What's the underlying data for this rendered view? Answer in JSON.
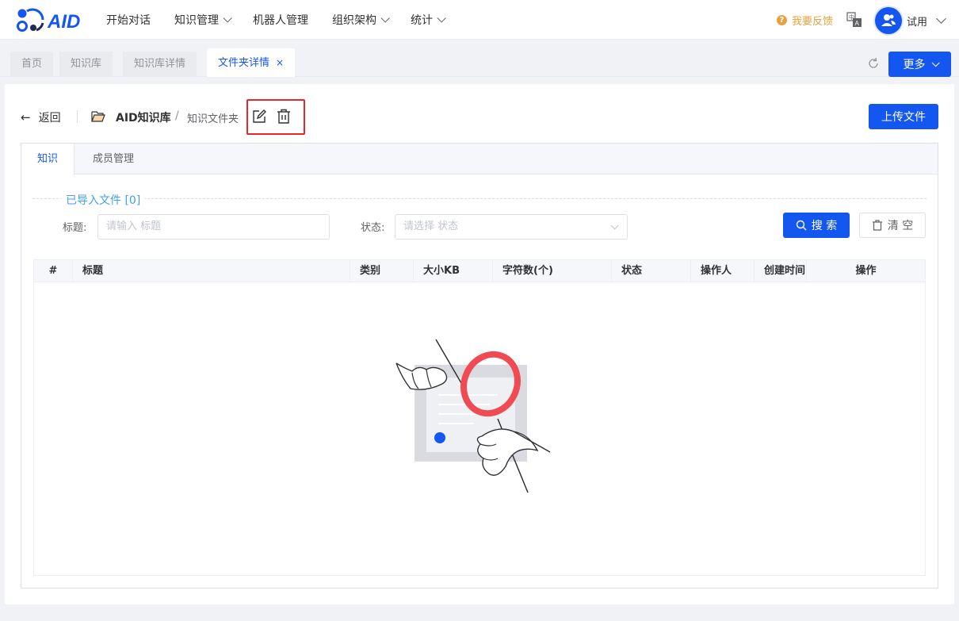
{
  "app": {
    "logo_text": "AID"
  },
  "nav": {
    "items": [
      {
        "label": "开始对话",
        "dropdown": false
      },
      {
        "label": "知识管理",
        "dropdown": true
      },
      {
        "label": "机器人管理",
        "dropdown": false
      },
      {
        "label": "组织架构",
        "dropdown": true
      },
      {
        "label": "统计",
        "dropdown": true
      }
    ],
    "feedback": "我要反馈",
    "user": "试用"
  },
  "page_tabs": [
    {
      "label": "首页",
      "active": false
    },
    {
      "label": "知识库",
      "active": false
    },
    {
      "label": "知识库详情",
      "active": false
    },
    {
      "label": "文件夹详情",
      "active": true,
      "close": "×"
    }
  ],
  "more_button": "更多",
  "header": {
    "back": "返回",
    "kb_name": "AID知识库",
    "separator": "/",
    "folder_name": "知识文件夹",
    "upload": "上传文件"
  },
  "inner_tabs": [
    {
      "label": "知识",
      "active": true
    },
    {
      "label": "成员管理",
      "active": false
    }
  ],
  "section_title": "已导入文件 [0]",
  "filters": {
    "title_label": "标题:",
    "title_placeholder": "请输入 标题",
    "status_label": "状态:",
    "status_placeholder": "请选择 状态",
    "search": "搜 索",
    "clear": "清 空"
  },
  "table": {
    "columns": [
      "#",
      "标题",
      "类别",
      "大小KB",
      "字符数(个)",
      "状态",
      "操作人",
      "创建时间",
      "操作"
    ],
    "rows": []
  },
  "colors": {
    "primary": "#1456f0",
    "highlight": "#e8272a",
    "feedback": "#e6a23c",
    "section": "#409eff"
  }
}
